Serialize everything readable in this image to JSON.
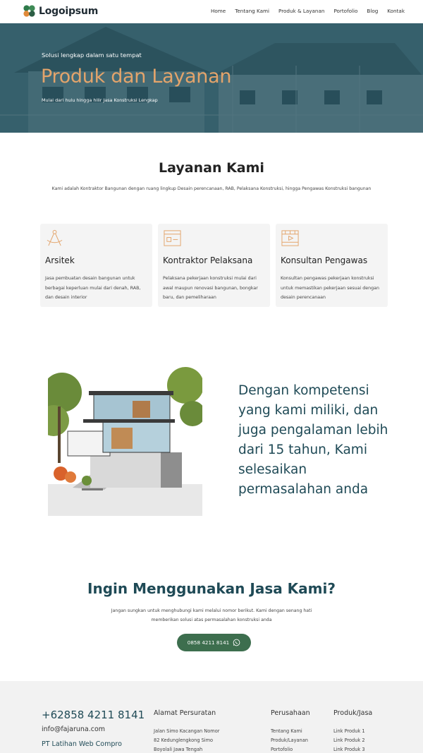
{
  "header": {
    "logo_text": "Logoipsum",
    "nav": [
      "Home",
      "Tentang Kami",
      "Produk & Layanan",
      "Portofolio",
      "Blog",
      "Kontak"
    ]
  },
  "hero": {
    "kicker": "Solusi lengkap dalam satu tempat",
    "title": "Produk dan Layanan",
    "subtitle": "Mulai dari hulu hingga hilir Jasa Konstruksi Lengkap"
  },
  "services": {
    "title": "Layanan Kami",
    "description": "Kami adalah Kontraktor Bangunan dengan ruang lingkup Desain perencanaan, RAB, Pelaksana Konstruksi, hingga Pengawas Konstruksi bangunan",
    "cards": [
      {
        "icon": "compass-icon",
        "title": "Arsitek",
        "text": "Jasa pembuatan desain bangunan untuk berbagai keperluan mulai dari denah, RAB, dan desain interior"
      },
      {
        "icon": "browser-window-icon",
        "title": "Kontraktor Pelaksana",
        "text": "Pelaksana pekerjaan konstruksi mulai dari awal maupun renovasi bangunan, bongkar baru, dan pemeliharaan"
      },
      {
        "icon": "video-film-icon",
        "title": "Konsultan Pengawas",
        "text": "Konsultan pengawas pekerjaan konstruksi untuk memastikan pekerjaan sesuai dengan desain perencanaan"
      }
    ]
  },
  "feature": {
    "text": "Dengan kompetensi yang kami miliki, dan juga pengalaman lebih dari 15 tahun, Kami selesaikan permasalahan anda"
  },
  "cta": {
    "title": "Ingin Menggunakan Jasa Kami?",
    "description": "Jangan sungkan untuk menghubungi kami melalui nomor berikut. Kami dengan senang hati memberikan solusi atas permasalahan konstruksi anda",
    "button": "0858 4211 8141"
  },
  "footer": {
    "phone": "+62858 4211 8141",
    "email": "info@fajaruna.com",
    "company": "PT Latihan Web Compro",
    "address_title": "Alamat Persuratan",
    "address_lines": [
      "Jalan Simo Kacangan Nomor",
      "82 Kedunglengkong Simo",
      "Boyolali Jawa Tengah"
    ],
    "perusahaan_title": "Perusahaan",
    "perusahaan_links": [
      "Tentang Kami",
      "Produk/Layanan",
      "Portofolio"
    ],
    "produk_title": "Produk/Jasa",
    "produk_links": [
      "Link Produk 1",
      "Link Produk 2",
      "Link Produk 3"
    ]
  },
  "colors": {
    "accent_orange": "#e3a46b",
    "teal": "#1f4a56",
    "button_green": "#3d6e4e"
  }
}
